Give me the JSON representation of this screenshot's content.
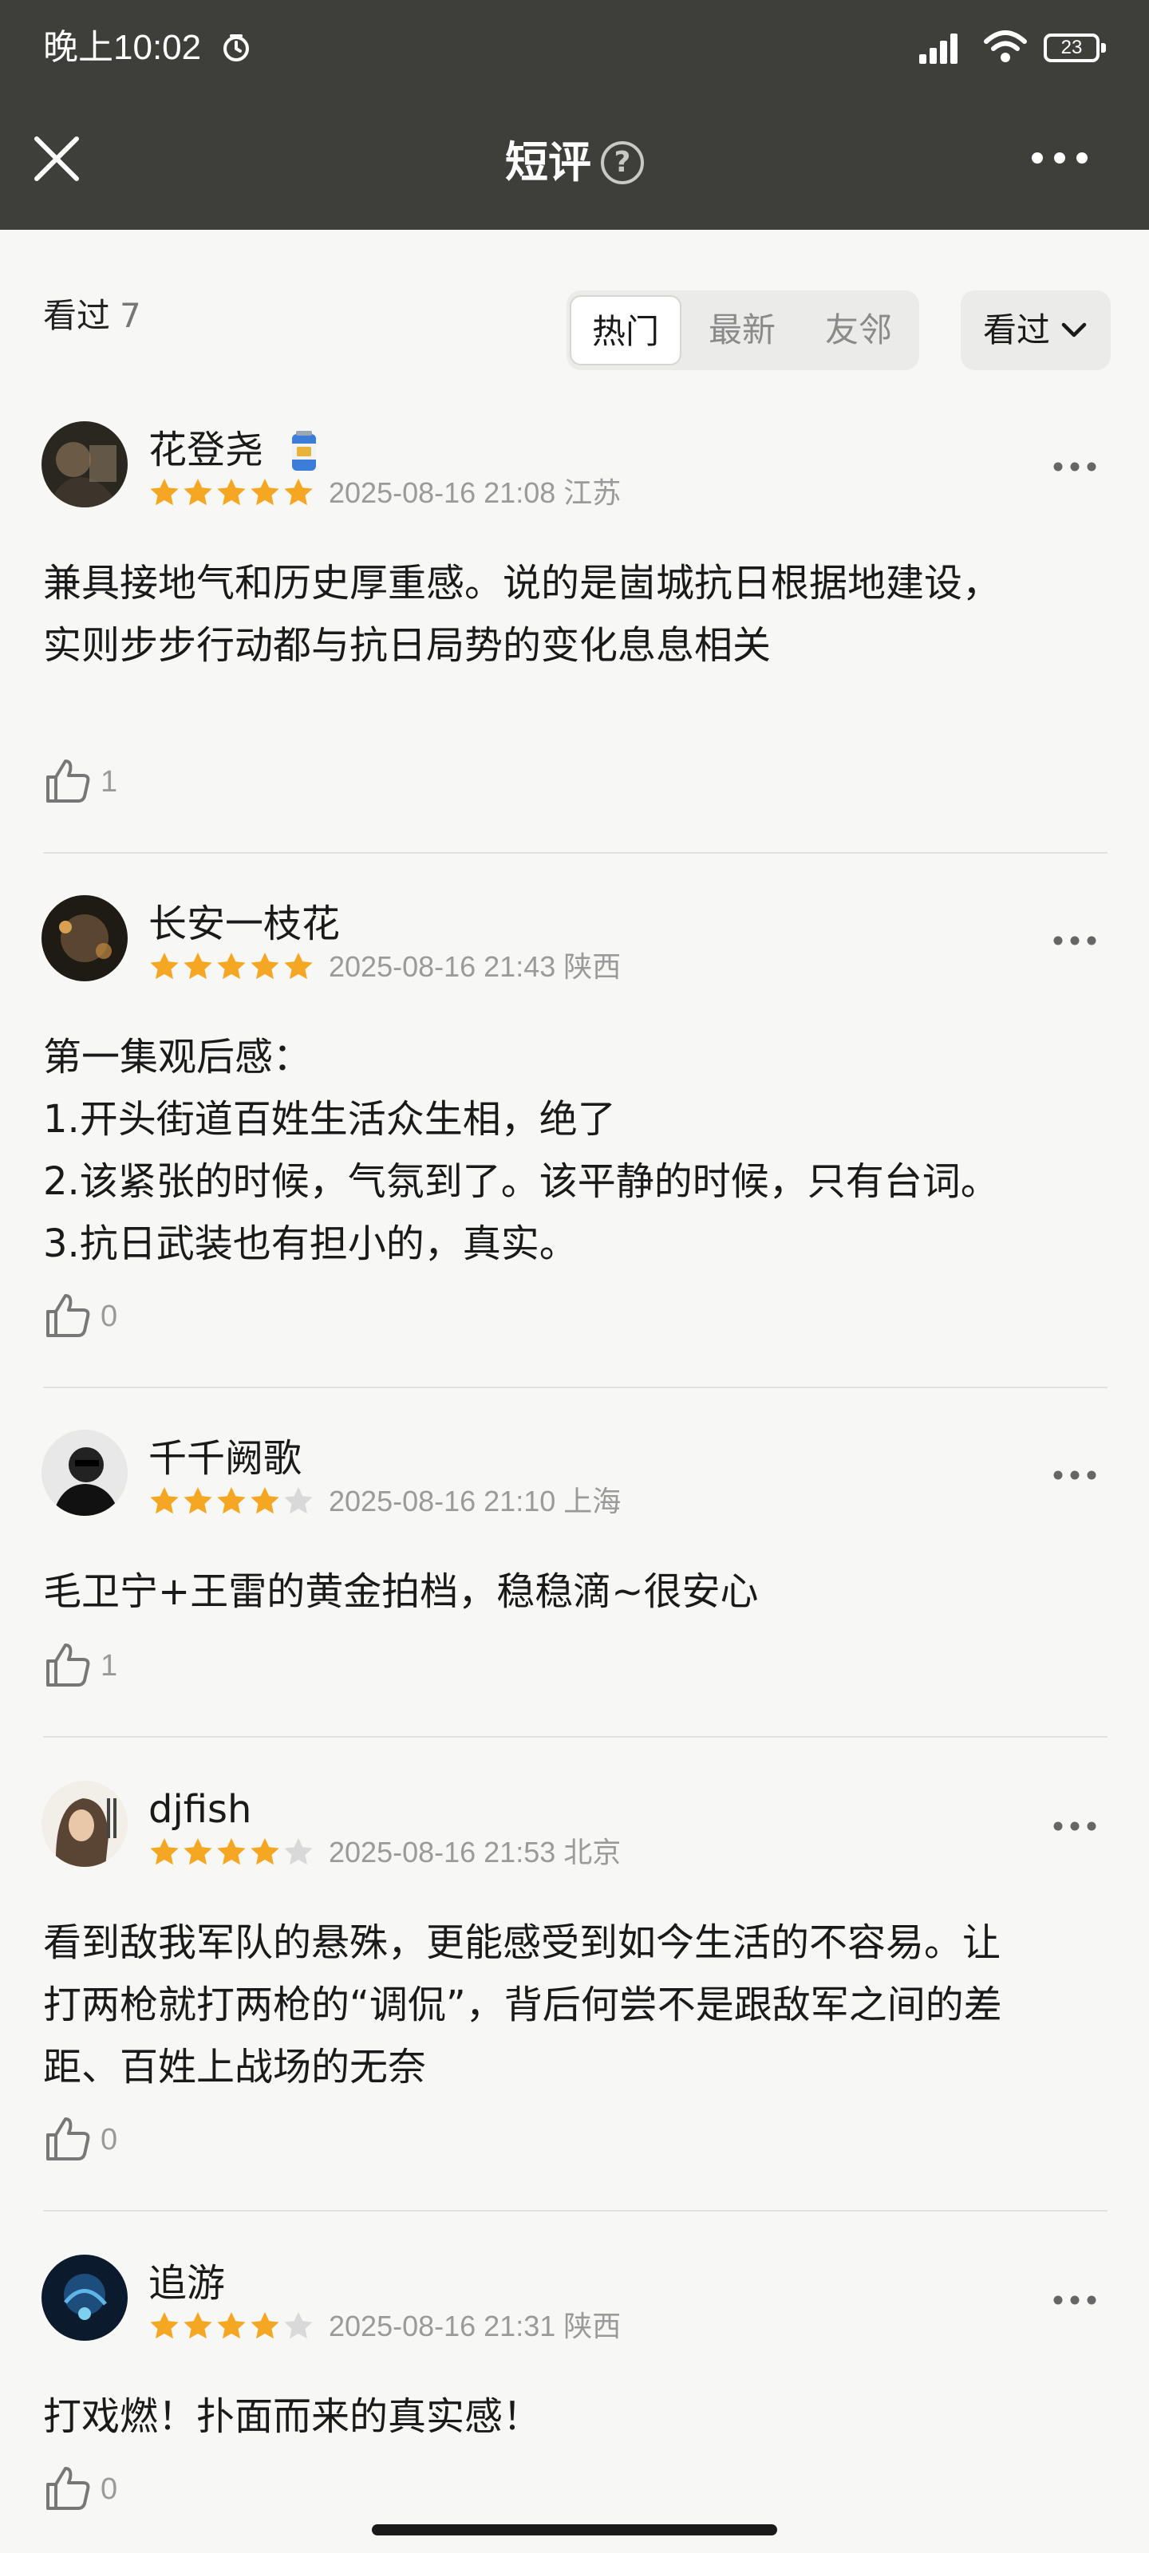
{
  "status_bar": {
    "time": "晚上10:02",
    "battery": "23"
  },
  "nav": {
    "title": "短评",
    "help_symbol": "?"
  },
  "filter": {
    "seen_label": "看过",
    "seen_count": "7",
    "tabs": [
      {
        "label": "热门",
        "active": true
      },
      {
        "label": "最新",
        "active": false
      },
      {
        "label": "友邻",
        "active": false
      }
    ],
    "sort_label": "看过"
  },
  "colors": {
    "star_on": "#f5a623",
    "star_off": "#d9d9d9",
    "topbar": "#3e3f3a"
  },
  "reviews": [
    {
      "name": "花登尧",
      "has_badge": true,
      "rating": 5,
      "time": "2025-08-16 21:08",
      "location": "江苏",
      "lines": [
        "兼具接地气和历史厚重感。说的是崮城抗日根据地建设，",
        "实则步步行动都与抗日局势的变化息息相关"
      ],
      "likes": "1"
    },
    {
      "name": "长安一枝花",
      "has_badge": false,
      "rating": 5,
      "time": "2025-08-16 21:43",
      "location": "陕西",
      "lines": [
        "第一集观后感：",
        "1.开头街道百姓生活众生相，绝了",
        "2.该紧张的时候，气氛到了。该平静的时候，只有台词。",
        "3.抗日武装也有担小的，真实。"
      ],
      "likes": "0"
    },
    {
      "name": "千千阙歌",
      "has_badge": false,
      "rating": 4,
      "time": "2025-08-16 21:10",
      "location": "上海",
      "lines": [
        "毛卫宁+王雷的黄金拍档，稳稳滴~很安心"
      ],
      "likes": "1"
    },
    {
      "name": "djfish",
      "has_badge": false,
      "rating": 4,
      "time": "2025-08-16 21:53",
      "location": "北京",
      "lines": [
        "看到敌我军队的悬殊，更能感受到如今生活的不容易。让",
        "打两枪就打两枪的“调侃”，背后何尝不是跟敌军之间的差",
        "距、百姓上战场的无奈"
      ],
      "likes": "0"
    },
    {
      "name": "追游",
      "has_badge": false,
      "rating": 4,
      "time": "2025-08-16 21:31",
      "location": "陕西",
      "lines": [
        "打戏燃！扑面而来的真实感！"
      ],
      "likes": "0"
    }
  ]
}
